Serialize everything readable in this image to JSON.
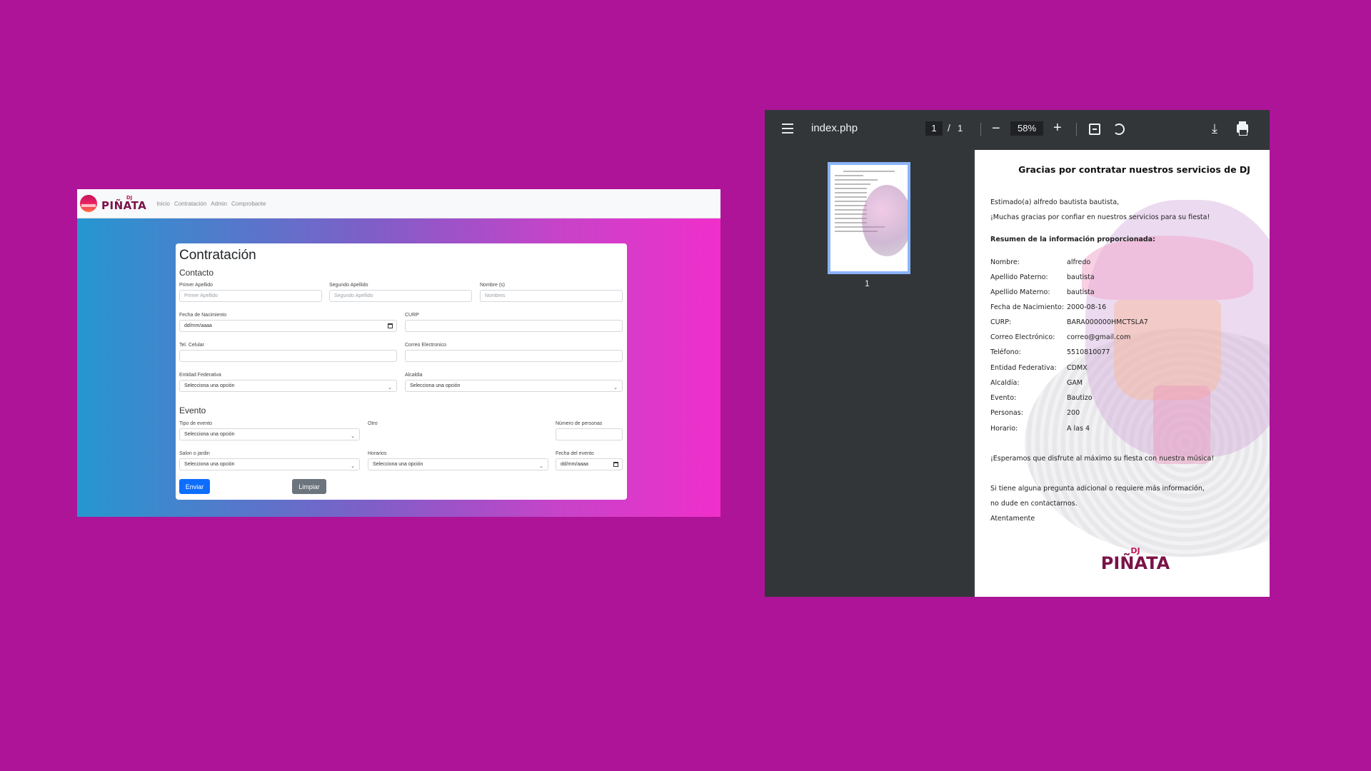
{
  "web": {
    "navbar": {
      "brand_dj": "DJ",
      "brand_name": "PIÑATA",
      "links": [
        "Inicio",
        "Contratación",
        "Admin",
        "Comprobante"
      ]
    },
    "form": {
      "title": "Contratación",
      "contacto_heading": "Contacto",
      "primer_apellido": {
        "label": "Primer Apellido",
        "placeholder": "Primer Apellido"
      },
      "segundo_apellido": {
        "label": "Segundo Apellido",
        "placeholder": "Segundo Apellido"
      },
      "nombres": {
        "label": "Nombre (s)",
        "placeholder": "Nombres"
      },
      "fecha_nacimiento": {
        "label": "Fecha de Nacimiento",
        "value": "dd/mm/aaaa"
      },
      "curp": {
        "label": "CURP",
        "value": ""
      },
      "tel_celular": {
        "label": "Tel. Celular",
        "value": ""
      },
      "correo": {
        "label": "Correo Electronico",
        "value": ""
      },
      "entidad": {
        "label": "Entidad Federativa",
        "value": "Selecciona una opción"
      },
      "alcaldia": {
        "label": "Alcaldia",
        "value": "Selecciona una opción"
      },
      "evento_heading": "Evento",
      "tipo_evento": {
        "label": "Tipo de evento",
        "value": "Selecciona una opción"
      },
      "otro": {
        "label": "Otro"
      },
      "numero_personas": {
        "label": "Número de personas",
        "value": ""
      },
      "salon": {
        "label": "Salon o jardin",
        "value": "Selecciona una opción"
      },
      "horarios": {
        "label": "Horarios",
        "value": "Selecciona una opción"
      },
      "fecha_evento": {
        "label": "Fecha del evento",
        "value": "dd/mm/aaaa"
      },
      "enviar_label": "Enviar",
      "limpiar_label": "Limpiar"
    }
  },
  "pdf_viewer": {
    "title": "index.php",
    "page_current": "1",
    "page_separator": "/",
    "page_total": "1",
    "zoom": "58%",
    "thumbnail_label": "1",
    "icons": [
      "menu-icon",
      "minus-icon",
      "plus-icon",
      "fit-page-icon",
      "rotate-icon",
      "download-icon",
      "print-icon",
      "more-vert-icon"
    ],
    "document": {
      "title": "Gracias por contratar nuestros servicios de DJ",
      "greeting": "Estimado(a) alfredo bautista bautista,",
      "thanks": "¡Muchas gracias por confiar en nuestros servicios para su fiesta!",
      "summary_heading": "Resumen de la información proporcionada:",
      "fields": [
        {
          "key": "Nombre:",
          "value": "alfredo"
        },
        {
          "key": "Apellido Paterno:",
          "value": "bautista"
        },
        {
          "key": "Apellido Materno:",
          "value": "bautista"
        },
        {
          "key": "Fecha de Nacimiento:",
          "value": "2000-08-16"
        },
        {
          "key": "CURP:",
          "value": "BARA000000HMCTSLA7"
        },
        {
          "key": "Correo Electrónico:",
          "value": "correo@gmail.com"
        },
        {
          "key": "Teléfono:",
          "value": "5510810077"
        },
        {
          "key": "Entidad Federativa:",
          "value": "CDMX"
        },
        {
          "key": "Alcaldía:",
          "value": "GAM"
        },
        {
          "key": "Evento:",
          "value": "Bautizo"
        },
        {
          "key": "Personas:",
          "value": "200"
        },
        {
          "key": "Horario:",
          "value": "A las 4"
        }
      ],
      "closing_1": "¡Esperamos que disfrute al máximo su fiesta con nuestra música!",
      "closing_2": "Si tiene alguna pregunta adicional o requiere más información,",
      "closing_3": "no dude en contactarnos.",
      "sign_off": "Atentamente",
      "logo_dj": "DJ",
      "logo_name": "PIÑATA"
    }
  },
  "colors": {
    "background": "#ad1497",
    "primary_button": "#0d6efd",
    "secondary_button": "#6c757d",
    "viewer_toolbar": "#323639",
    "logo_purple": "#7b1249"
  }
}
